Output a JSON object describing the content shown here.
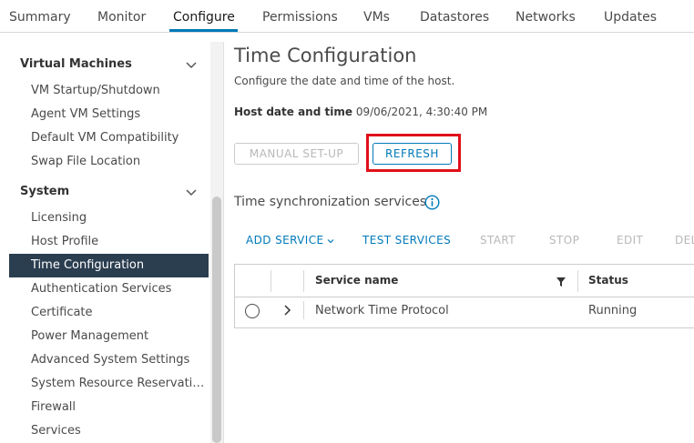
{
  "tabs": [
    {
      "label": "Summary"
    },
    {
      "label": "Monitor"
    },
    {
      "label": "Configure"
    },
    {
      "label": "Permissions"
    },
    {
      "label": "VMs"
    },
    {
      "label": "Datastores"
    },
    {
      "label": "Networks"
    },
    {
      "label": "Updates"
    }
  ],
  "sidebar": {
    "sections": [
      {
        "label": "Virtual Machines"
      },
      {
        "label": "System"
      }
    ],
    "items": [
      {
        "label": "VM Startup/Shutdown"
      },
      {
        "label": "Agent VM Settings"
      },
      {
        "label": "Default VM Compatibility"
      },
      {
        "label": "Swap File Location"
      },
      {
        "label": "Licensing"
      },
      {
        "label": "Host Profile"
      },
      {
        "label": "Time Configuration"
      },
      {
        "label": "Authentication Services"
      },
      {
        "label": "Certificate"
      },
      {
        "label": "Power Management"
      },
      {
        "label": "Advanced System Settings"
      },
      {
        "label": "System Resource Reservati…"
      },
      {
        "label": "Firewall"
      },
      {
        "label": "Services"
      }
    ]
  },
  "main": {
    "title": "Time Configuration",
    "subtitle": "Configure the date and time of the host.",
    "host_dt_label": "Host date and time",
    "host_dt_value": "09/06/2021, 4:30:40 PM",
    "manual_setup_label": "MANUAL SET-UP",
    "refresh_label": "REFRESH",
    "sync_title": "Time synchronization services",
    "actions": [
      {
        "label": "ADD SERVICE"
      },
      {
        "label": "TEST SERVICES"
      },
      {
        "label": "START"
      },
      {
        "label": "STOP"
      },
      {
        "label": "EDIT"
      },
      {
        "label": "DEL"
      }
    ],
    "table": {
      "headers": [
        "Service name",
        "Status"
      ],
      "rows": [
        {
          "service": "Network Time Protocol",
          "status": "Running"
        }
      ]
    }
  },
  "colors": {
    "accent": "#0079b8",
    "sidebar_active_bg": "#2b3e50",
    "highlight": "#e0101a"
  }
}
